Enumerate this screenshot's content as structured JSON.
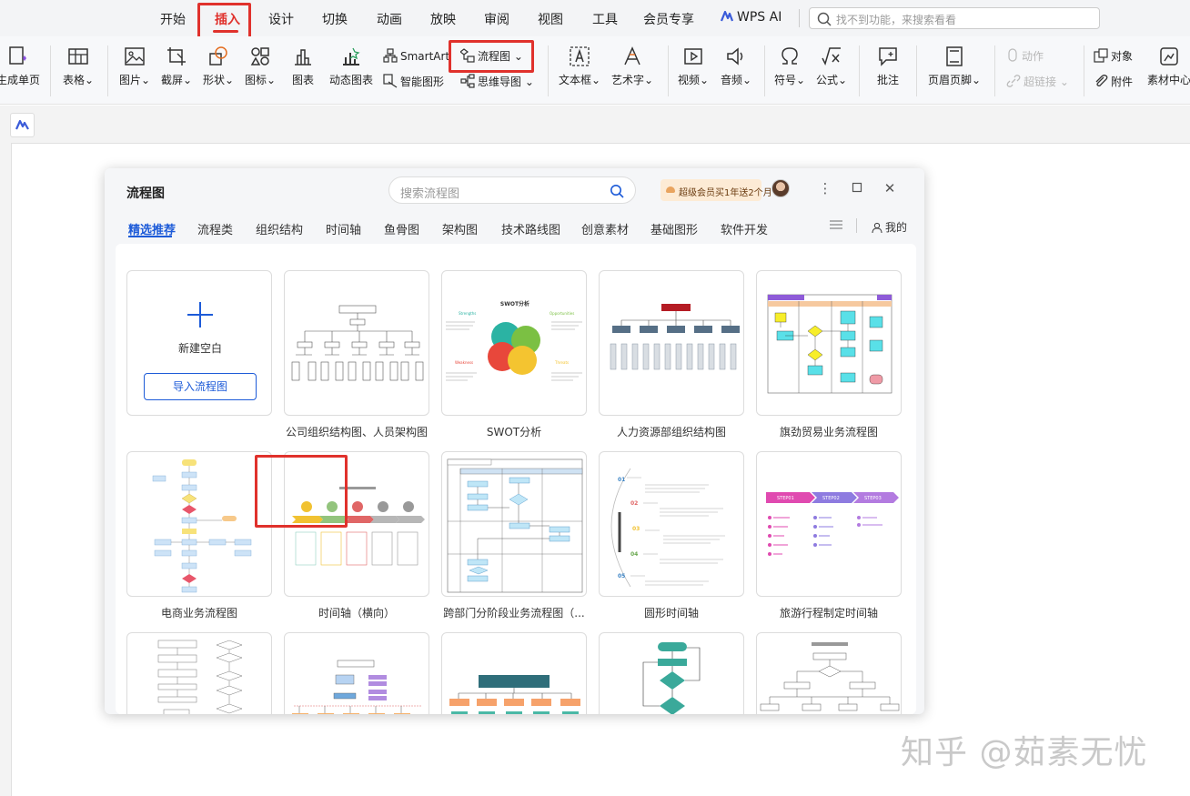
{
  "menu": {
    "items": [
      "开始",
      "插入",
      "设计",
      "切换",
      "动画",
      "放映",
      "审阅",
      "视图",
      "工具",
      "会员专享"
    ],
    "active": "插入",
    "wps_ai": "WPS AI",
    "search_placeholder": "找不到功能，来搜索看看"
  },
  "toolbar": {
    "generate_page": "生成单页",
    "table": "表格",
    "picture": "图片",
    "screenshot": "截屏",
    "shape": "形状",
    "icon": "图标",
    "chart": "图表",
    "dynamic_chart": "动态图表",
    "smartart": "SmartArt",
    "smart_shape": "智能图形",
    "flowchart": "流程图",
    "mindmap": "思维导图",
    "textbox": "文本框",
    "wordart": "艺术字",
    "video": "视频",
    "audio": "音频",
    "symbol": "符号",
    "formula": "公式",
    "comment": "批注",
    "header_footer": "页眉页脚",
    "action": "动作",
    "hyperlink": "超链接",
    "object": "对象",
    "attachment": "附件",
    "material_center": "素材中心"
  },
  "dialog": {
    "title": "流程图",
    "search_placeholder": "搜索流程图",
    "vip_text": "超级会员买1年送2个月",
    "tabs": [
      "精选推荐",
      "流程类",
      "组织结构",
      "时间轴",
      "鱼骨图",
      "架构图",
      "技术路线图",
      "创意素材",
      "基础图形",
      "软件开发"
    ],
    "mine": "我的",
    "new_blank": "新建空白",
    "import_button": "导入流程图",
    "templates": [
      "公司组织结构图、人员架构图",
      "SWOT分析",
      "人力资源部组织结构图",
      "旗劲贸易业务流程图",
      "电商业务流程图",
      "时间轴（横向）",
      "跨部门分阶段业务流程图（...",
      "圆形时间轴",
      "旅游行程制定时间轴"
    ],
    "swot": {
      "title": "SWOT分析",
      "strengths": "Strengths",
      "opportunities": "Opportunities",
      "weaknesses": "Weakness",
      "threats": "Threats"
    },
    "travel_steps": [
      "STEP01",
      "STEP02",
      "STEP03"
    ],
    "circle_timeline_numbers": [
      "01",
      "02",
      "03",
      "04",
      "05"
    ]
  },
  "watermark": "知乎 @茹素无忧",
  "colors": {
    "accent_red": "#e0312c",
    "active_blue": "#1d5bd8"
  }
}
